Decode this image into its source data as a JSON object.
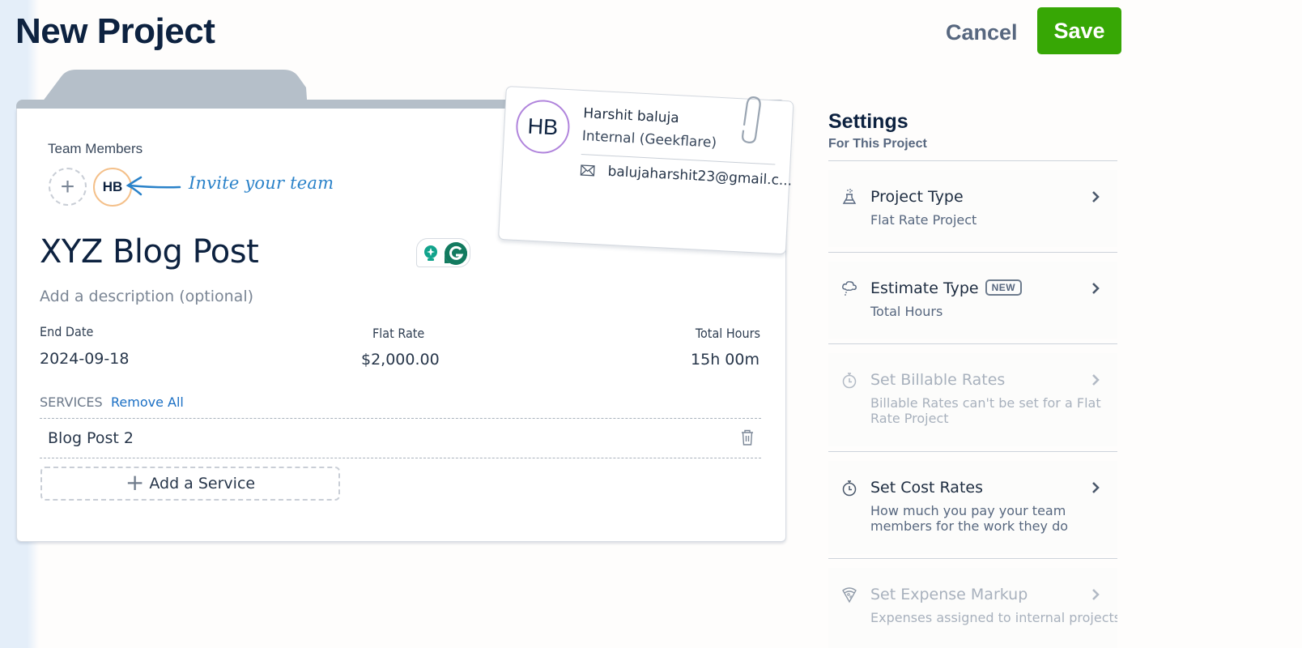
{
  "header": {
    "title": "New Project",
    "cancel_label": "Cancel",
    "save_label": "Save"
  },
  "colors": {
    "save_green": "#37a705",
    "link_blue": "#1a6fc4",
    "heading_navy": "#0d2240",
    "member_avatar_border": "#f4c08a",
    "card_avatar_border": "#b084dc",
    "invite_annotation": "#2a82c9"
  },
  "project": {
    "team_members_label": "Team Members",
    "add_member_icon": "plus-icon",
    "members": [
      {
        "initials": "HB"
      }
    ],
    "invite_annotation": "Invite your team",
    "name": "XYZ Blog Post",
    "description_placeholder": "Add a description (optional)",
    "fields": {
      "end_date": {
        "label": "End Date",
        "value": "2024-09-18"
      },
      "flat_rate": {
        "label": "Flat Rate",
        "value": "$2,000.00"
      },
      "total_hours": {
        "label": "Total Hours",
        "value": "15h 00m"
      }
    },
    "services": {
      "label": "SERVICES",
      "remove_all_label": "Remove All",
      "items": [
        {
          "name": "Blog Post 2",
          "icon": "trash-icon"
        }
      ],
      "add_label": "Add a Service"
    }
  },
  "contact_card": {
    "initials": "HB",
    "name": "Harshit baluja",
    "organization": "Internal (Geekflare)",
    "email": "balujaharshit23@gmail.c...",
    "email_icon": "envelope-icon",
    "decoration_icon": "paperclip-icon"
  },
  "settings": {
    "title": "Settings",
    "subtitle": "For This Project",
    "items": [
      {
        "title": "Project Type",
        "description": "Flat Rate Project",
        "icon": "flask-icon",
        "enabled": true
      },
      {
        "title": "Estimate Type",
        "badge": "NEW",
        "description": "Total Hours",
        "icon": "cloud-icon",
        "enabled": true
      },
      {
        "title": "Set Billable Rates",
        "description": "Billable Rates can't be set for a Flat Rate Project",
        "icon": "stopwatch-icon",
        "enabled": false
      },
      {
        "title": "Set Cost Rates",
        "description": "How much you pay your team members for the work they do",
        "icon": "stopwatch-icon",
        "enabled": true
      },
      {
        "title": "Set Expense Markup",
        "description": "Expenses assigned to internal projects",
        "icon": "pizza-icon",
        "enabled": false
      }
    ]
  }
}
